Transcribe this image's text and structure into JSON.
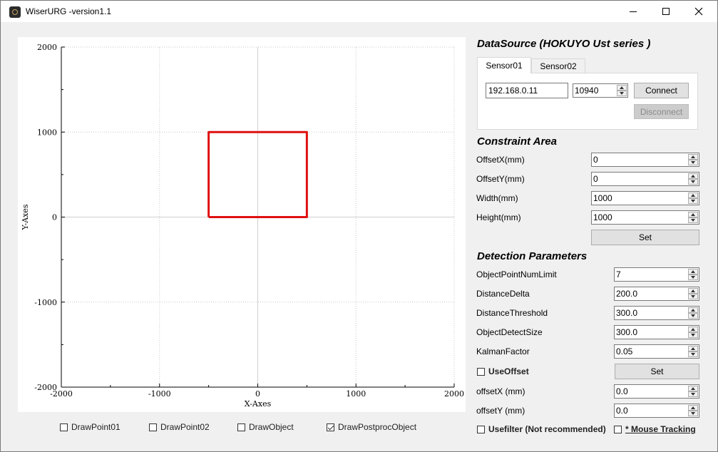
{
  "window": {
    "title": "WiserURG -version1.1",
    "minimize_icon": "minimize-icon",
    "maximize_icon": "maximize-icon",
    "close_icon": "close-icon"
  },
  "chart_data": {
    "type": "line",
    "xlabel": "X-Axes",
    "ylabel": "Y-Axes",
    "xlim": [
      -2000,
      2000
    ],
    "ylim": [
      -2000,
      2000
    ],
    "xticks": [
      "-2000",
      "-1000",
      "0",
      "1000",
      "2000"
    ],
    "yticks": [
      "2000",
      "1000",
      "0",
      "-1000",
      "-2000"
    ],
    "grid": true,
    "series": [
      {
        "color": "#e01010",
        "x": [
          -500,
          500,
          500,
          -500,
          -500
        ],
        "y": [
          0,
          0,
          1000,
          1000,
          0
        ]
      }
    ]
  },
  "draw_options": [
    {
      "label": "DrawPoint01",
      "checked": false
    },
    {
      "label": "DrawPoint02",
      "checked": false
    },
    {
      "label": "DrawObject",
      "checked": false
    },
    {
      "label": "DrawPostprocObject",
      "checked": true
    }
  ],
  "datasource": {
    "title": "DataSource (HOKUYO Ust series )",
    "tabs": [
      "Sensor01",
      "Sensor02"
    ],
    "ip": "192.168.0.11",
    "port": "10940",
    "connect_label": "Connect",
    "disconnect_label": "Disconnect"
  },
  "constraint": {
    "title": "Constraint Area",
    "fields": [
      {
        "label": "OffsetX(mm)",
        "value": "0"
      },
      {
        "label": "OffsetY(mm)",
        "value": "0"
      },
      {
        "label": "Width(mm)",
        "value": "1000"
      },
      {
        "label": "Height(mm)",
        "value": "1000"
      }
    ],
    "set_label": "Set"
  },
  "detection": {
    "title": "Detection Parameters",
    "fields": [
      {
        "label": "ObjectPointNumLimit",
        "value": "7"
      },
      {
        "label": "DistanceDelta",
        "value": "200.0"
      },
      {
        "label": "DistanceThreshold",
        "value": "300.0"
      },
      {
        "label": "ObjectDetectSize",
        "value": "300.0"
      },
      {
        "label": "KalmanFactor",
        "value": "0.05"
      }
    ],
    "use_offset_label": "UseOffset",
    "use_offset_checked": false,
    "set_label": "Set",
    "offset_fields": [
      {
        "label": "offsetX (mm)",
        "value": "0.0"
      },
      {
        "label": "offsetY (mm)",
        "value": "0.0"
      }
    ],
    "usefilter_label": "Usefilter (Not recommended)",
    "usefilter_checked": false,
    "mouse_tracking_label": "* Mouse Tracking",
    "mouse_tracking_checked": false
  }
}
